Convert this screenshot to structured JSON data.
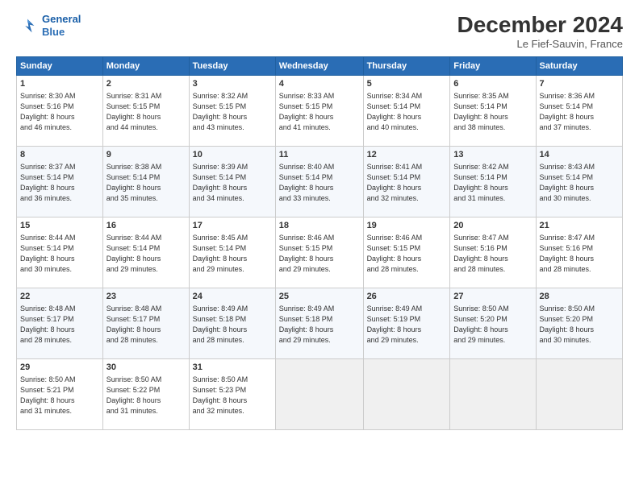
{
  "logo": {
    "line1": "General",
    "line2": "Blue"
  },
  "title": "December 2024",
  "location": "Le Fief-Sauvin, France",
  "weekdays": [
    "Sunday",
    "Monday",
    "Tuesday",
    "Wednesday",
    "Thursday",
    "Friday",
    "Saturday"
  ],
  "weeks": [
    [
      {
        "day": "1",
        "sunrise": "8:30 AM",
        "sunset": "5:16 PM",
        "daylight": "8 hours and 46 minutes."
      },
      {
        "day": "2",
        "sunrise": "8:31 AM",
        "sunset": "5:15 PM",
        "daylight": "8 hours and 44 minutes."
      },
      {
        "day": "3",
        "sunrise": "8:32 AM",
        "sunset": "5:15 PM",
        "daylight": "8 hours and 43 minutes."
      },
      {
        "day": "4",
        "sunrise": "8:33 AM",
        "sunset": "5:15 PM",
        "daylight": "8 hours and 41 minutes."
      },
      {
        "day": "5",
        "sunrise": "8:34 AM",
        "sunset": "5:14 PM",
        "daylight": "8 hours and 40 minutes."
      },
      {
        "day": "6",
        "sunrise": "8:35 AM",
        "sunset": "5:14 PM",
        "daylight": "8 hours and 38 minutes."
      },
      {
        "day": "7",
        "sunrise": "8:36 AM",
        "sunset": "5:14 PM",
        "daylight": "8 hours and 37 minutes."
      }
    ],
    [
      {
        "day": "8",
        "sunrise": "8:37 AM",
        "sunset": "5:14 PM",
        "daylight": "8 hours and 36 minutes."
      },
      {
        "day": "9",
        "sunrise": "8:38 AM",
        "sunset": "5:14 PM",
        "daylight": "8 hours and 35 minutes."
      },
      {
        "day": "10",
        "sunrise": "8:39 AM",
        "sunset": "5:14 PM",
        "daylight": "8 hours and 34 minutes."
      },
      {
        "day": "11",
        "sunrise": "8:40 AM",
        "sunset": "5:14 PM",
        "daylight": "8 hours and 33 minutes."
      },
      {
        "day": "12",
        "sunrise": "8:41 AM",
        "sunset": "5:14 PM",
        "daylight": "8 hours and 32 minutes."
      },
      {
        "day": "13",
        "sunrise": "8:42 AM",
        "sunset": "5:14 PM",
        "daylight": "8 hours and 31 minutes."
      },
      {
        "day": "14",
        "sunrise": "8:43 AM",
        "sunset": "5:14 PM",
        "daylight": "8 hours and 30 minutes."
      }
    ],
    [
      {
        "day": "15",
        "sunrise": "8:44 AM",
        "sunset": "5:14 PM",
        "daylight": "8 hours and 30 minutes."
      },
      {
        "day": "16",
        "sunrise": "8:44 AM",
        "sunset": "5:14 PM",
        "daylight": "8 hours and 29 minutes."
      },
      {
        "day": "17",
        "sunrise": "8:45 AM",
        "sunset": "5:14 PM",
        "daylight": "8 hours and 29 minutes."
      },
      {
        "day": "18",
        "sunrise": "8:46 AM",
        "sunset": "5:15 PM",
        "daylight": "8 hours and 29 minutes."
      },
      {
        "day": "19",
        "sunrise": "8:46 AM",
        "sunset": "5:15 PM",
        "daylight": "8 hours and 28 minutes."
      },
      {
        "day": "20",
        "sunrise": "8:47 AM",
        "sunset": "5:16 PM",
        "daylight": "8 hours and 28 minutes."
      },
      {
        "day": "21",
        "sunrise": "8:47 AM",
        "sunset": "5:16 PM",
        "daylight": "8 hours and 28 minutes."
      }
    ],
    [
      {
        "day": "22",
        "sunrise": "8:48 AM",
        "sunset": "5:17 PM",
        "daylight": "8 hours and 28 minutes."
      },
      {
        "day": "23",
        "sunrise": "8:48 AM",
        "sunset": "5:17 PM",
        "daylight": "8 hours and 28 minutes."
      },
      {
        "day": "24",
        "sunrise": "8:49 AM",
        "sunset": "5:18 PM",
        "daylight": "8 hours and 28 minutes."
      },
      {
        "day": "25",
        "sunrise": "8:49 AM",
        "sunset": "5:18 PM",
        "daylight": "8 hours and 29 minutes."
      },
      {
        "day": "26",
        "sunrise": "8:49 AM",
        "sunset": "5:19 PM",
        "daylight": "8 hours and 29 minutes."
      },
      {
        "day": "27",
        "sunrise": "8:50 AM",
        "sunset": "5:20 PM",
        "daylight": "8 hours and 29 minutes."
      },
      {
        "day": "28",
        "sunrise": "8:50 AM",
        "sunset": "5:20 PM",
        "daylight": "8 hours and 30 minutes."
      }
    ],
    [
      {
        "day": "29",
        "sunrise": "8:50 AM",
        "sunset": "5:21 PM",
        "daylight": "8 hours and 31 minutes."
      },
      {
        "day": "30",
        "sunrise": "8:50 AM",
        "sunset": "5:22 PM",
        "daylight": "8 hours and 31 minutes."
      },
      {
        "day": "31",
        "sunrise": "8:50 AM",
        "sunset": "5:23 PM",
        "daylight": "8 hours and 32 minutes."
      },
      null,
      null,
      null,
      null
    ]
  ]
}
